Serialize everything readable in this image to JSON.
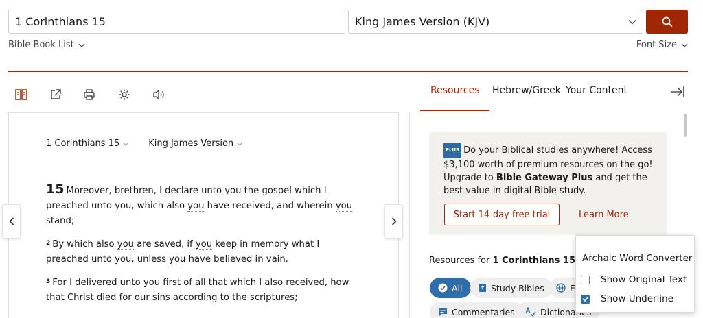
{
  "search": {
    "value": "1 Corinthians 15",
    "placeholder": ""
  },
  "version": {
    "selected": "King James Version (KJV)"
  },
  "links": {
    "book_list": "Bible Book List",
    "font_size": "Font Size"
  },
  "tabs": [
    {
      "label": "Resources",
      "active": true
    },
    {
      "label": "Hebrew/Greek",
      "active": false
    },
    {
      "label": "Your Content",
      "active": false
    }
  ],
  "passage": {
    "reference": "1 Corinthians 15",
    "version": "King James Version",
    "verses": [
      {
        "num": "15",
        "parts": [
          "Moreover, brethren, I declare unto you the gospel which I preached unto you, which also ",
          "you",
          " have received, and wherein ",
          "you",
          " stand;"
        ]
      },
      {
        "num": "2",
        "parts": [
          "By which also ",
          "you",
          " are saved, if ",
          "you",
          " keep in memory what I preached unto you, unless ",
          "you",
          " have believed in vain."
        ]
      },
      {
        "num": "3",
        "parts": [
          "For I delivered unto you first of all that which I also received, how that Christ died for our sins according to the scriptures;"
        ]
      }
    ]
  },
  "promo": {
    "badge": "PLUS",
    "text_1": "Do your Biblical studies anywhere! Access $3,100 worth of premium resources on the go! Upgrade to ",
    "text_bold": "Bible Gateway Plus",
    "text_2": " and get the best value in digital Bible study.",
    "trial_label": "Start 14-day free trial",
    "learn_more": "Learn More"
  },
  "resources": {
    "prefix": "Resources for ",
    "reference": "1 Corinthians 15",
    "chips": [
      "All",
      "Study Bibles",
      "E",
      "Commentaries",
      "Dictionaries"
    ]
  },
  "popup": {
    "title": "Archaic Word Converter",
    "options": [
      {
        "label": "Show Original Text",
        "checked": false
      },
      {
        "label": "Show Underline",
        "checked": true
      }
    ]
  },
  "colors": {
    "accent": "#a12606",
    "blue": "#2f6ea8"
  }
}
